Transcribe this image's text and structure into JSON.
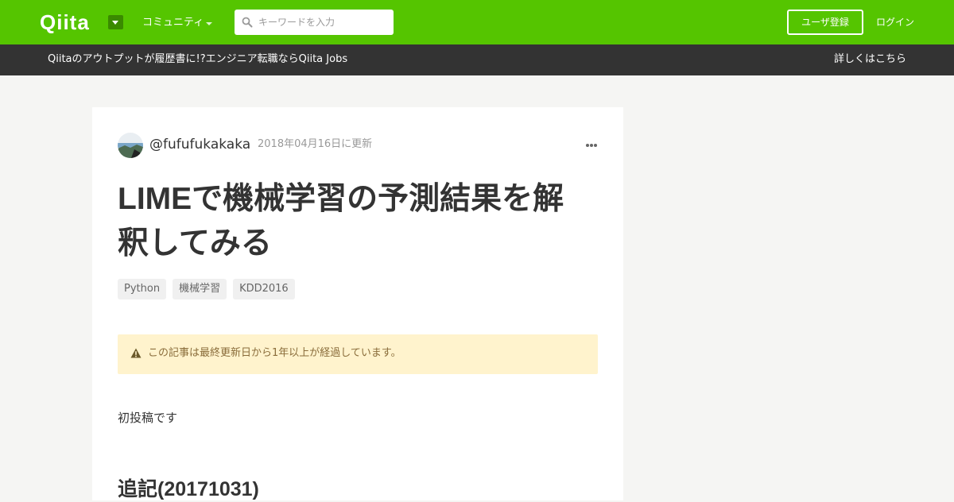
{
  "header": {
    "logo": "Qiita",
    "community_label": "コミュニティ",
    "search_placeholder": "キーワードを入力",
    "signup_label": "ユーザ登録",
    "login_label": "ログイン",
    "brand_color": "#55c500"
  },
  "banner": {
    "text": "Qiitaのアウトプットが履歴書に!?エンジニア転職ならQiita Jobs",
    "link_label": "詳しくはこちら"
  },
  "article": {
    "author": "@fufufukakaka",
    "updated": "2018年04月16日に更新",
    "title": "LIMEで機械学習の予測結果を解釈してみる",
    "tags": [
      "Python",
      "機械学習",
      "KDD2016"
    ],
    "warning": "この記事は最終更新日から1年以上が経過しています。",
    "body_intro": "初投稿です",
    "section_heading": "追記(20171031)"
  }
}
